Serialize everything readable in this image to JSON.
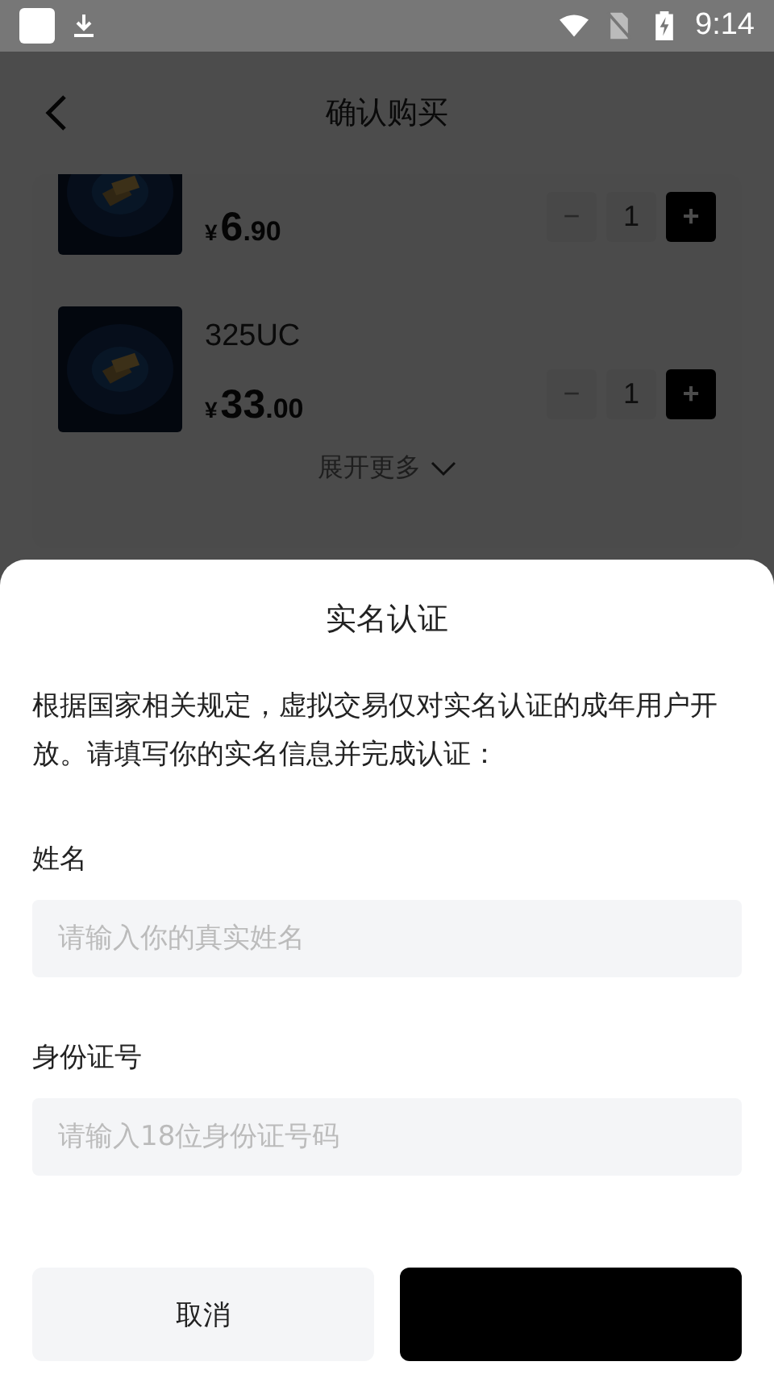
{
  "status_bar": {
    "time": "9:14"
  },
  "header": {
    "title": "确认购买"
  },
  "products": [
    {
      "currency": "¥",
      "price_integer": "6",
      "price_decimal": ".90",
      "quantity": "1",
      "minus": "−",
      "plus": "+",
      "minus_disabled": true,
      "cut_top": true
    },
    {
      "name": "325UC",
      "currency": "¥",
      "price_integer": "33",
      "price_decimal": ".00",
      "quantity": "1",
      "minus": "−",
      "plus": "+",
      "minus_disabled": true,
      "cut_top": false
    }
  ],
  "expand": {
    "label": "展开更多"
  },
  "sheet": {
    "title": "实名认证",
    "description": "根据国家相关规定，虚拟交易仅对实名认证的成年用户开放。请填写你的实名信息并完成认证：",
    "fields": [
      {
        "label": "姓名",
        "placeholder": "请输入你的真实姓名"
      },
      {
        "label": "身份证号",
        "placeholder": "请输入18位身份证号码"
      }
    ],
    "buttons": [
      {
        "kind": "secondary",
        "label": "取消"
      },
      {
        "kind": "primary"
      }
    ]
  }
}
